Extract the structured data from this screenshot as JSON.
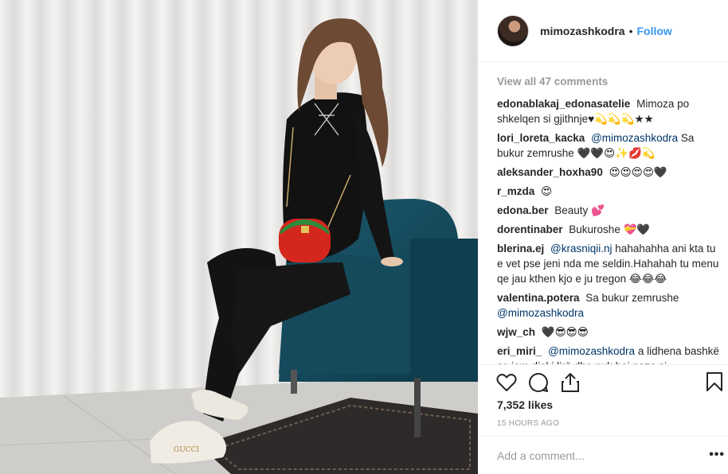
{
  "post": {
    "photo_alt": "",
    "author": "mimozashkodra",
    "separator": "•",
    "follow_label": "Follow"
  },
  "comments": {
    "view_all": "View all 47 comments",
    "items": [
      {
        "user": "edonablakaj_edonasatelie",
        "mention": "",
        "text": "Mimoza po shkelqen si gjithnje♥︎💫💫💫★★"
      },
      {
        "user": "lori_loreta_kacka",
        "mention": "@mimozashkodra",
        "text": "Sa bukur zemrushe 🖤🖤😍✨💋💫"
      },
      {
        "user": "aleksander_hoxha90",
        "mention": "",
        "text": "😍😍😍😍🖤"
      },
      {
        "user": "r_mzda",
        "mention": "",
        "text": "😍"
      },
      {
        "user": "edona.ber",
        "mention": "",
        "text": "Beauty 💕"
      },
      {
        "user": "dorentinaber",
        "mention": "",
        "text": "Bukuroshe 💝🖤"
      },
      {
        "user": "blerina.ej",
        "mention": "@krasniqii.nj",
        "text": "hahahahha ani kta tu e vet pse jeni nda me seldin.Hahahah tu menu qe jau kthen kjo e ju tregon 😂😂😂"
      },
      {
        "user": "valentina.potera",
        "mention": "",
        "text": "Sa bukur zemrushe",
        "mention_after": "@mimozashkodra"
      },
      {
        "user": "wjw_ch",
        "mention": "",
        "text": "🖤😎😎😎"
      },
      {
        "user": "eri_miri_",
        "mention": "@mimozashkodra",
        "text": "a lidhena bashkë se iam dial i lirë dhe nuk bai naze si"
      }
    ]
  },
  "actions": {
    "like_icon": "heart-icon",
    "comment_icon": "comment-icon",
    "share_icon": "share-icon",
    "save_icon": "bookmark-icon",
    "likes": "7,352 likes",
    "timestamp": "15 HOURS AGO"
  },
  "add_comment": {
    "placeholder": "Add a comment...",
    "more_label": "•••"
  },
  "colors": {
    "follow": "#3897f0",
    "mention": "#003569",
    "muted": "#999999",
    "text": "#262626",
    "divider": "#efefef"
  }
}
